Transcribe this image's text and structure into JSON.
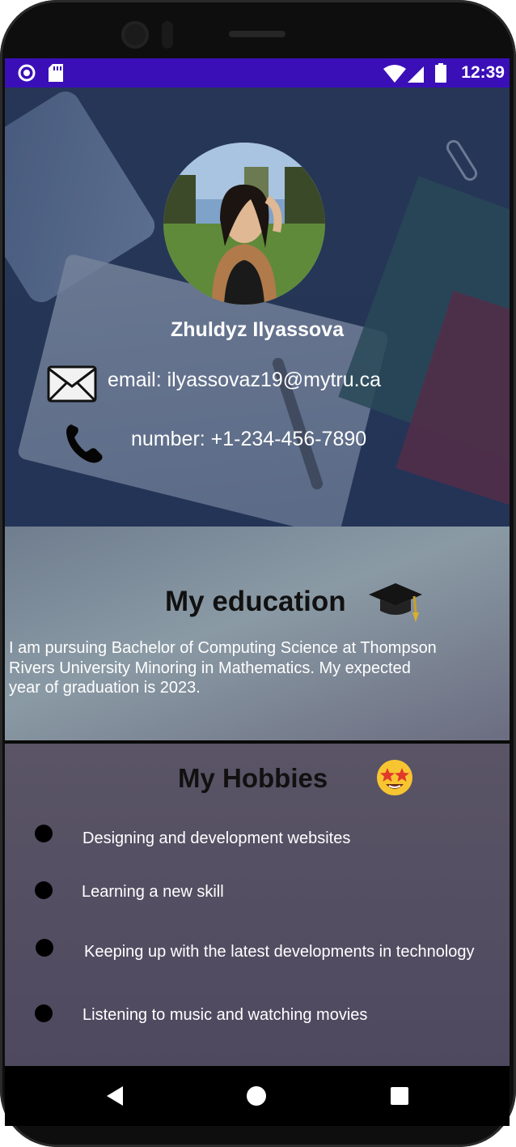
{
  "status_bar": {
    "time": "12:39",
    "icons": [
      "sync-icon",
      "sd-card-icon",
      "wifi-icon",
      "cellular-signal-icon",
      "battery-icon"
    ],
    "color": "#3a0fb8"
  },
  "profile": {
    "name": "Zhuldyz Ilyassova",
    "email_line": "email: ilyassovaz19@mytru.ca",
    "phone_line": "number: +1-234-456-7890"
  },
  "education": {
    "title": "My education",
    "emoji": "graduation-cap-icon",
    "lines": [
      "I am pursuing Bachelor of Computing Science at Thompson",
      "Rivers University Minoring in Mathematics. My expected",
      "year of graduation is 2023."
    ]
  },
  "hobbies": {
    "title": "My Hobbies",
    "emoji": "star-struck-emoji-icon",
    "items": [
      "Designing and development websites",
      "Learning a new skill",
      "Keeping up with the latest developments in technology",
      "Listening to music and watching movies"
    ]
  },
  "nav": {
    "buttons": [
      "back-icon",
      "home-icon",
      "recents-icon"
    ]
  }
}
